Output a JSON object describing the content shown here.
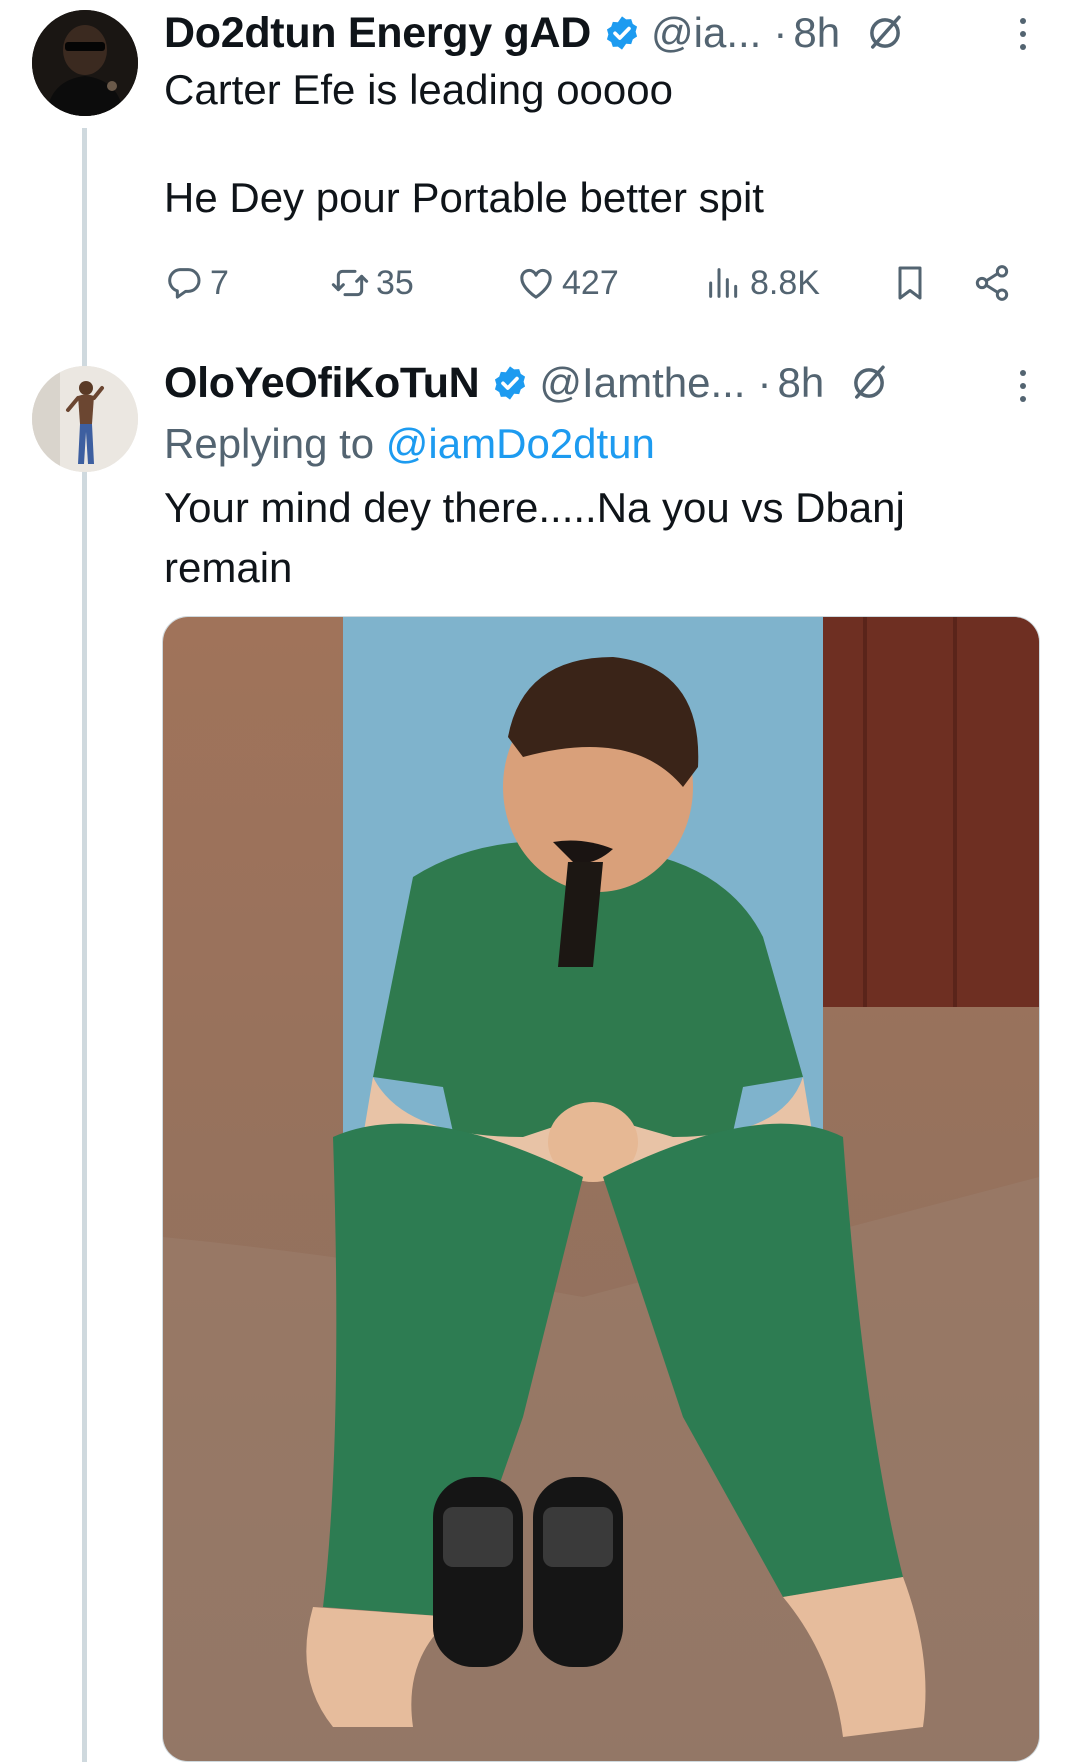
{
  "tweets": [
    {
      "author": {
        "name": "Do2dtun Energy gAD",
        "handle": "@ia...",
        "verified": true
      },
      "dot": "·",
      "time": "8h",
      "lines": [
        "Carter Efe is leading ooooo",
        "",
        "He Dey pour Portable better spit"
      ],
      "stats": {
        "replies": "7",
        "retweets": "35",
        "likes": "427",
        "views": "8.8K"
      }
    },
    {
      "author": {
        "name": "OloYeOfiKoTuN",
        "handle": "@Iamthe...",
        "verified": true
      },
      "dot": "·",
      "time": "8h",
      "replying_prefix": "Replying to",
      "replying_to": "@iamDo2dtun",
      "lines": [
        "Your mind dey there.....Na you vs Dbanj",
        "remain"
      ],
      "media": {
        "alt": "photo"
      }
    }
  ],
  "colors": {
    "accent": "#1d9bf0",
    "secondary_text": "#536471",
    "thread_line": "#cfd9de"
  },
  "icons": [
    "reply-icon",
    "retweet-icon",
    "like-icon",
    "views-icon",
    "bookmark-icon",
    "share-icon",
    "verified-badge-icon",
    "more-icon",
    "edited-icon"
  ]
}
